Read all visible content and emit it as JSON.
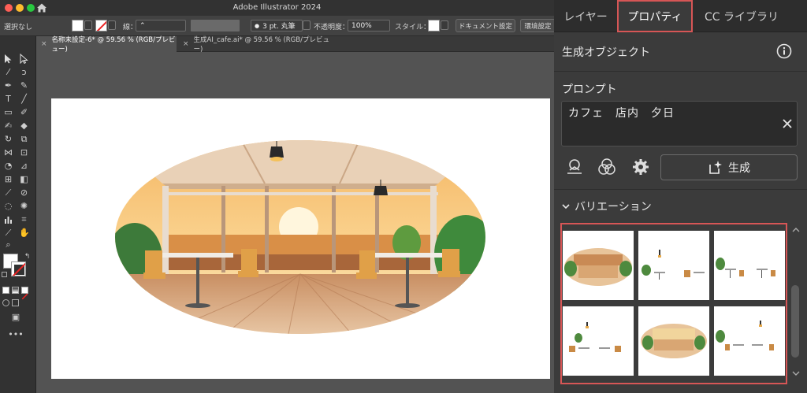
{
  "window": {
    "app_title": "Adobe Illustrator 2024"
  },
  "control_bar": {
    "selection_label": "選択なし",
    "stroke_label": "線：",
    "stroke_style_value": "3 pt. 丸筆",
    "opacity_label": "不透明度：",
    "opacity_value": "100%",
    "style_label": "スタイル：",
    "document_setup_label": "ドキュメント設定",
    "environment_label": "環境設定"
  },
  "doc_tabs": [
    {
      "label": "名称未設定-6* @ 59.56 % (RGB/プレビュー)",
      "active": true
    },
    {
      "label": "生成AI_cafe.ai* @ 59.56 % (RGB/プレビュー)",
      "active": false
    }
  ],
  "panel": {
    "tabs": [
      {
        "label": "レイヤー",
        "active": false
      },
      {
        "label": "プロパティ",
        "active": true
      },
      {
        "label": "CC ライブラリ",
        "active": false
      }
    ],
    "section_title": "生成オブジェクト",
    "prompt_label": "プロンプト",
    "prompt_text": "カフェ　店内　夕日",
    "generate_label": "生成",
    "variations_label": "バリエーション",
    "variation_count": 6
  },
  "colors": {
    "accent_red": "#d75656",
    "panel_bg": "#3b3b3b",
    "toolbar_bg": "#323232",
    "canvas_bg": "#535353"
  },
  "icons": {
    "home": "home-icon",
    "info": "info-icon",
    "clear": "close-icon",
    "recolor": "recolor-icon",
    "shape-builder": "intersect-circles-icon",
    "settings": "gear-icon",
    "generate": "sparkle-frame-icon",
    "chevron": "chevron-down-icon"
  }
}
